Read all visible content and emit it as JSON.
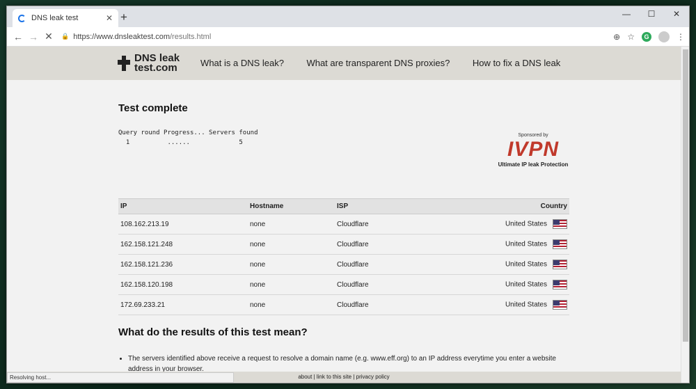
{
  "browser": {
    "tab_title": "DNS leak test",
    "tab_close": "✕",
    "new_tab": "+",
    "url_host": "https://www.dnsleaktest.com",
    "url_path": "/results.html",
    "status_text": "Resolving host..."
  },
  "site": {
    "logo_line1": "DNS leak",
    "logo_line2": "test.com",
    "nav": [
      "What is a DNS leak?",
      "What are transparent DNS proxies?",
      "How to fix a DNS leak"
    ]
  },
  "results": {
    "heading": "Test complete",
    "progress_header": "Query round Progress... Servers found",
    "progress_values": "  1          ......             5",
    "sponsor_by": "Sponsored by",
    "sponsor_brand": "IVPN",
    "sponsor_tagline": "Ultimate IP leak Protection",
    "columns": [
      "IP",
      "Hostname",
      "ISP",
      "Country"
    ],
    "rows": [
      {
        "ip": "108.162.213.19",
        "hostname": "none",
        "isp": "Cloudflare",
        "country": "United States"
      },
      {
        "ip": "162.158.121.248",
        "hostname": "none",
        "isp": "Cloudflare",
        "country": "United States"
      },
      {
        "ip": "162.158.121.236",
        "hostname": "none",
        "isp": "Cloudflare",
        "country": "United States"
      },
      {
        "ip": "162.158.120.198",
        "hostname": "none",
        "isp": "Cloudflare",
        "country": "United States"
      },
      {
        "ip": "172.69.233.21",
        "hostname": "none",
        "isp": "Cloudflare",
        "country": "United States"
      }
    ]
  },
  "meaning": {
    "heading": "What do the results of this test mean?",
    "bullet1": "The servers identified above receive a request to resolve a domain name (e.g. www.eff.org) to an IP address everytime you enter a website address in your browser."
  },
  "footer": {
    "about": "about",
    "link": "link to this site",
    "privacy": "privacy policy"
  }
}
